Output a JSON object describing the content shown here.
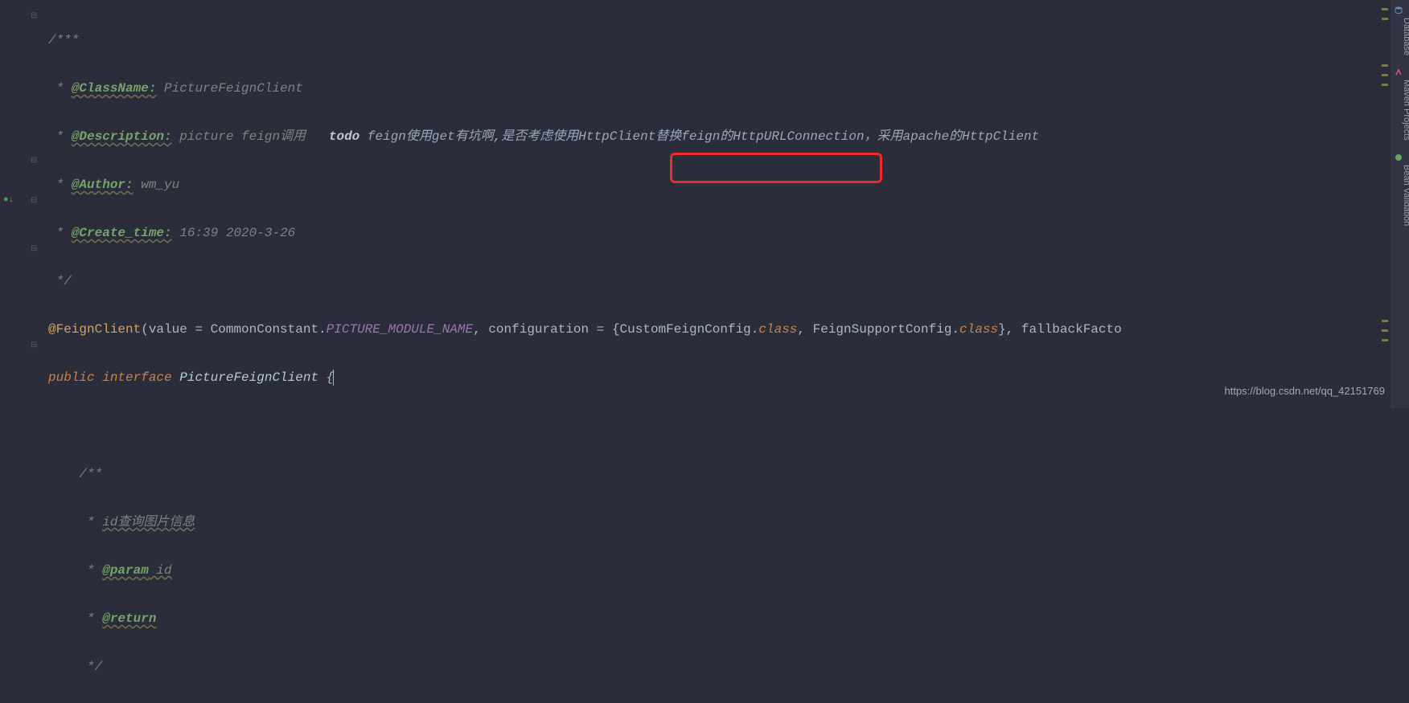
{
  "code": {
    "l1": "/***",
    "l2_star": " * ",
    "l2_tag": "@ClassName:",
    "l2_val": " PictureFeignClient",
    "l3_star": " * ",
    "l3_tag": "@Description:",
    "l3_val": " picture feign调用   ",
    "l3_todo": "todo ",
    "l3_todotext": "feign使用get有坑啊,是否考虑使用HttpClient替换feign的HttpURLConnection，采用apache的HttpClient",
    "l4_star": " * ",
    "l4_tag": "@Author:",
    "l4_val": " wm_yu",
    "l5_star": " * ",
    "l5_tag": "@Create_time:",
    "l5_val": " 16:39 2020-3-26",
    "l6": " */",
    "l7_anno": "@FeignClient",
    "l7_p1": "(",
    "l7_a1": "value = CommonConstant",
    "l7_dot": ".",
    "l7_const": "PICTURE_MODULE_NAME",
    "l7_a2": ", configuration = ",
    "l7_b1": "{",
    "l7_c1": "CustomFeignConfig",
    "l7_d1": ".",
    "l7_k1": "class",
    "l7_c2": ", FeignSupportConfig",
    "l7_d2": ".",
    "l7_k2": "class",
    "l7_b2": "}",
    "l7_a3": ", fallbackFacto",
    "l8_kw": "public interface ",
    "l8_cls": "PictureFeignClient ",
    "l8_br": "{",
    "l9": "",
    "l10": "    /**",
    "l11_star": "     * ",
    "l11_txt": "id查询图片信息",
    "l12_star": "     * ",
    "l12_tag": "@param",
    "l12_val": " id",
    "l13_star": "     * ",
    "l13_tag": "@return",
    "l14": "     */"
  },
  "tabs": {
    "database": "Database",
    "maven": "Maven Projects",
    "bean": "Bean Validation"
  },
  "watermark": "https://blog.csdn.net/qq_42151769"
}
